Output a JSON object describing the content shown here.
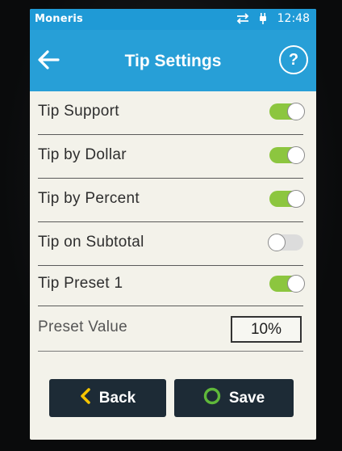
{
  "status_bar": {
    "app_name": "Moneris",
    "time": "12:48",
    "icons": [
      "data-transfer-icon",
      "plug-icon"
    ]
  },
  "header": {
    "title": "Tip Settings",
    "back_icon": "back-arrow-icon",
    "help_label": "?"
  },
  "settings": [
    {
      "label": "Tip Support",
      "enabled": true
    },
    {
      "label": "Tip by Dollar",
      "enabled": true
    },
    {
      "label": "Tip by Percent",
      "enabled": true
    },
    {
      "label": "Tip on Subtotal",
      "enabled": false
    },
    {
      "label": "Tip Preset 1",
      "enabled": true
    }
  ],
  "preset": {
    "label": "Preset Value",
    "value": "10%"
  },
  "actions": {
    "back_label": "Back",
    "save_label": "Save"
  },
  "colors": {
    "header_blue": "#279fd7",
    "toggle_on": "#8cc63f",
    "toggle_off": "#dcdcdc",
    "button_dark": "#1d2b36",
    "back_chevron": "#f5c400",
    "save_circle": "#5fb83a"
  }
}
